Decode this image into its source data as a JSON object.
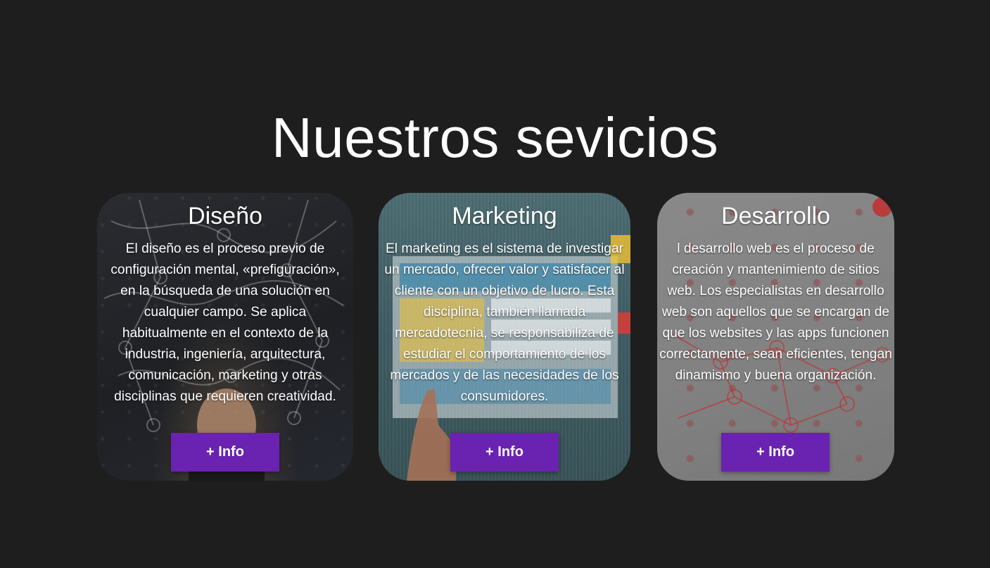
{
  "page": {
    "title": "Nuestros sevicios",
    "accent_color": "#6a22b0",
    "background_color": "#1e1e1e"
  },
  "services": [
    {
      "title": "Diseño",
      "description": "El diseño es el proceso previo de configuración mental, «prefiguración», en la búsqueda de una solución en cualquier campo. Se aplica habitualmente en el contexto de la industria, ingeniería, arquitectura, comunicación, marketing y otras disciplinas que requieren creatividad.",
      "button_label": "+ Info"
    },
    {
      "title": "Marketing",
      "description": "El marketing es el sistema de investigar un mercado, ofrecer valor y satisfacer al cliente con un objetivo de lucro. Esta disciplina, también llamada mercadotecnia, se responsabiliza de estudiar el comportamiento de los mercados y de las necesidades de los consumidores.",
      "button_label": "+ Info"
    },
    {
      "title": "Desarrollo",
      "description": "l desarrollo web es el proceso de creación y mantenimiento de sitios web. Los especialistas en desarrollo web son aquellos que se encargan de que los websites y las apps funcionen correctamente, sean eficientes, tengan dinamismo y buena organización.",
      "button_label": "+ Info"
    }
  ]
}
